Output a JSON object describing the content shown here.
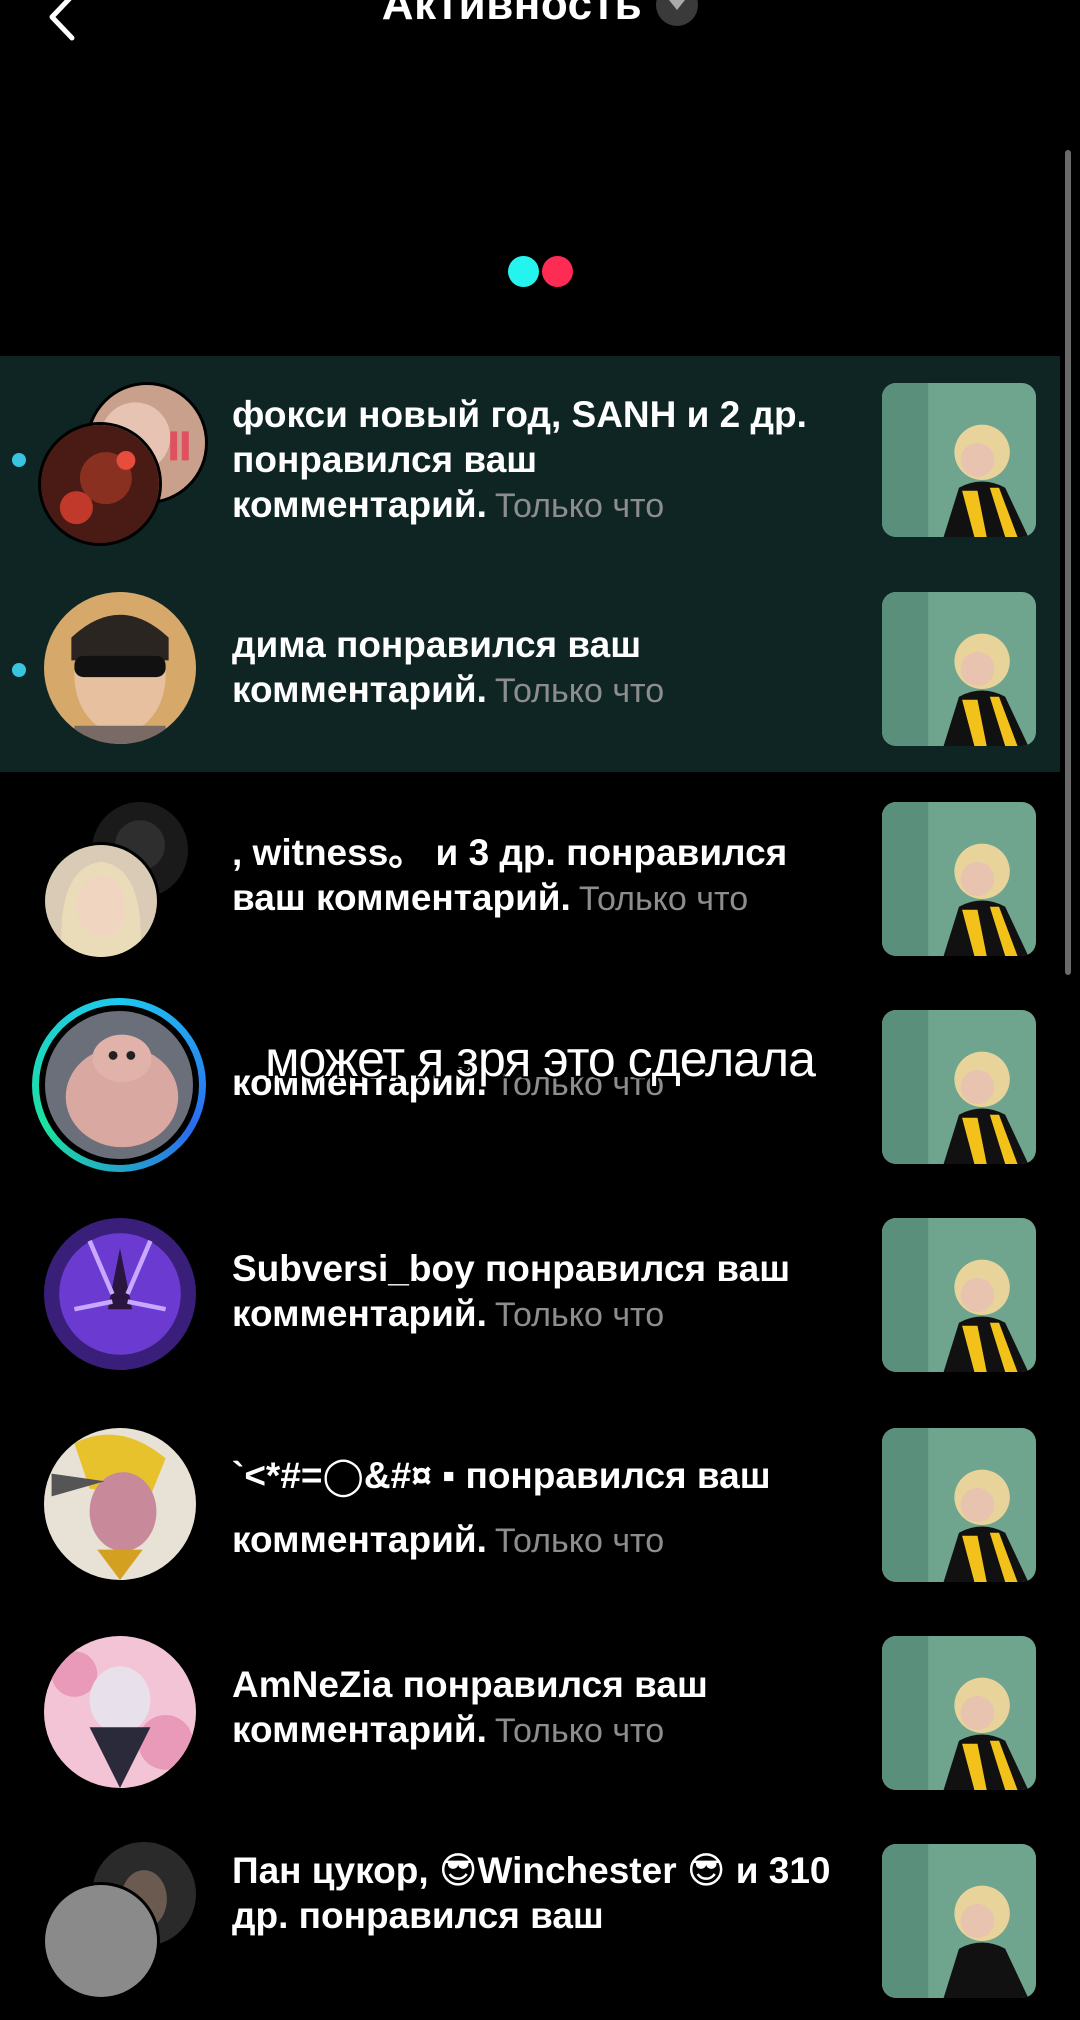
{
  "header": {
    "title": "Активность"
  },
  "icons": {
    "back": "chevron-left-icon",
    "caret": "caret-down-icon",
    "loader": "tiktok-loader-dots"
  },
  "colors": {
    "unread_bg": "#0e2524",
    "unread_dot": "#39c5e0",
    "cyan": "#25f4ee",
    "red": "#fe2c55",
    "time": "#8d8d8d"
  },
  "items": [
    {
      "user": "фокси новый год, SANH и 2 др.",
      "action": "понравился ваш комментарий.",
      "time": "Только что",
      "unread": true
    },
    {
      "user": "дима",
      "action": "понравился ваш комментарий.",
      "time": "Только что",
      "unread": true
    },
    {
      "user": ", witness。 и 3 др.",
      "action": "понравился ваш комментарий.",
      "time": "Только что",
      "unread": false
    },
    {
      "user": "",
      "action": "комментарий.",
      "time": "Только что",
      "unread": false
    },
    {
      "user": "Subversi_boy",
      "action": "понравился ваш комментарий.",
      "time": "Только что",
      "unread": false
    },
    {
      "user": "`<*#=◯&#¤ ▪",
      "action": "понравился ваш комментарий.",
      "time": "Только что",
      "unread": false
    },
    {
      "user": "AmNeZia",
      "action": "понравился ваш комментарий.",
      "time": "Только что",
      "unread": false
    },
    {
      "user": "Пан цукор, 😎Winchester 😎 и 310 др.",
      "action": "понравился ваш",
      "time": "",
      "unread": false
    }
  ],
  "overlay_caption": "может я зря это сделала"
}
